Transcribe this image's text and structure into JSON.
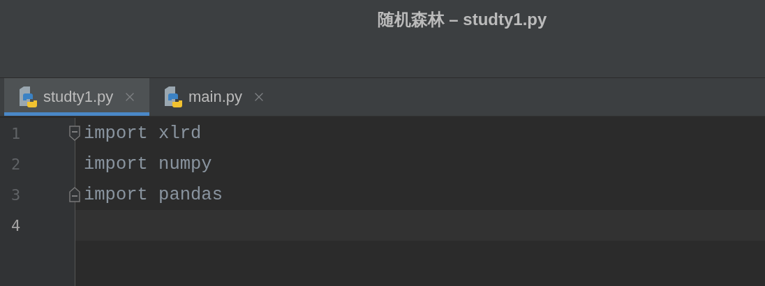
{
  "window": {
    "title": "随机森林 – studty1.py"
  },
  "tabs": [
    {
      "label": "studty1.py",
      "selected": true
    },
    {
      "label": "main.py",
      "selected": false
    }
  ],
  "editor": {
    "lines": [
      {
        "number": "1",
        "text": "import xlrd",
        "kind": "start",
        "current": false
      },
      {
        "number": "2",
        "text": "import numpy",
        "kind": "plain",
        "current": false
      },
      {
        "number": "3",
        "text": "import pandas",
        "kind": "end",
        "current": false
      },
      {
        "number": "4",
        "kind": "plain",
        "current": true
      }
    ]
  }
}
